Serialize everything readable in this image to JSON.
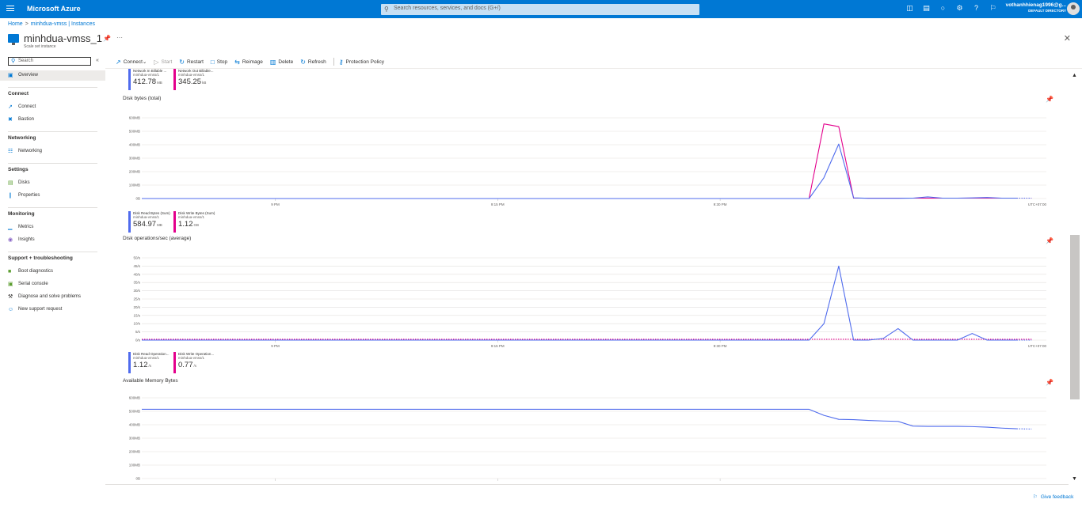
{
  "topbar": {
    "brand": "Microsoft Azure",
    "search_placeholder": "Search resources, services, and docs (G+/)",
    "icons": [
      "cloud-shell-icon",
      "directory-filter-icon",
      "notifications-icon",
      "settings-icon",
      "help-icon",
      "feedback-icon"
    ],
    "user_name": "vothanhhienag1996@g...",
    "user_directory": "DEFAULT DIRECTORY"
  },
  "breadcrumb": {
    "home": "Home",
    "parent": "minhdua-vmss | Instances"
  },
  "resource": {
    "title": "minhdua-vmss_1",
    "subtitle": "Scale set instance"
  },
  "sidebar": {
    "search_placeholder": "Search",
    "items": [
      {
        "type": "item",
        "label": "Overview",
        "icon": "overview-icon",
        "active": true
      },
      {
        "type": "head",
        "label": "Connect"
      },
      {
        "type": "item",
        "label": "Connect",
        "icon": "connect-icon"
      },
      {
        "type": "item",
        "label": "Bastion",
        "icon": "bastion-icon"
      },
      {
        "type": "head",
        "label": "Networking"
      },
      {
        "type": "item",
        "label": "Networking",
        "icon": "networking-icon"
      },
      {
        "type": "head",
        "label": "Settings"
      },
      {
        "type": "item",
        "label": "Disks",
        "icon": "disks-icon"
      },
      {
        "type": "item",
        "label": "Properties",
        "icon": "properties-icon"
      },
      {
        "type": "head",
        "label": "Monitoring"
      },
      {
        "type": "item",
        "label": "Metrics",
        "icon": "metrics-icon"
      },
      {
        "type": "item",
        "label": "Insights",
        "icon": "insights-icon"
      },
      {
        "type": "head",
        "label": "Support + troubleshooting"
      },
      {
        "type": "item",
        "label": "Boot diagnostics",
        "icon": "boot-diagnostics-icon"
      },
      {
        "type": "item",
        "label": "Serial console",
        "icon": "serial-console-icon"
      },
      {
        "type": "item",
        "label": "Diagnose and solve problems",
        "icon": "wrench-icon"
      },
      {
        "type": "item",
        "label": "New support request",
        "icon": "support-icon"
      }
    ]
  },
  "toolbar": {
    "buttons": [
      {
        "label": "Connect",
        "icon": "connect-icon",
        "dropdown": true,
        "disabled": false
      },
      {
        "label": "Start",
        "icon": "play-icon",
        "disabled": true
      },
      {
        "label": "Restart",
        "icon": "restart-icon",
        "disabled": false
      },
      {
        "label": "Stop",
        "icon": "stop-icon",
        "disabled": false
      },
      {
        "label": "Reimage",
        "icon": "reimage-icon",
        "disabled": false
      },
      {
        "label": "Delete",
        "icon": "trash-icon",
        "disabled": false
      },
      {
        "label": "Refresh",
        "icon": "refresh-icon",
        "disabled": false
      },
      {
        "label": "Protection Policy",
        "icon": "key-icon",
        "disabled": false,
        "separator_before": true
      }
    ]
  },
  "top_legend": [
    {
      "name": "Network In Billable ...",
      "resource": "minhdua-vmss/1",
      "value": "412.78",
      "unit": "MB",
      "color": "#4f6bed"
    },
    {
      "name": "Network Out Billable...",
      "resource": "minhdua-vmss/1",
      "value": "345.25",
      "unit": "kB",
      "color": "#e3008c"
    }
  ],
  "charts": {
    "disk_bytes": {
      "title": "Disk bytes (total)",
      "legend": [
        {
          "name": "Disk Read Bytes (Sum)",
          "resource": "minhdua-vmss/1",
          "value": "584.97",
          "unit": "MB",
          "color": "#4f6bed"
        },
        {
          "name": "Disk Write Bytes (Sum)",
          "resource": "minhdua-vmss/1",
          "value": "1.12",
          "unit": "GB",
          "color": "#e3008c"
        }
      ]
    },
    "disk_ops": {
      "title": "Disk operations/sec (average)",
      "legend": [
        {
          "name": "Disk Read Operation...",
          "resource": "minhdua-vmss/1",
          "value": "1.12",
          "unit": "/s",
          "color": "#4f6bed"
        },
        {
          "name": "Disk Write Operation...",
          "resource": "minhdua-vmss/1",
          "value": "0.77",
          "unit": "/s",
          "color": "#e3008c"
        }
      ]
    },
    "memory": {
      "title": "Available Memory Bytes"
    }
  },
  "chart_data": [
    {
      "type": "line",
      "title": "Disk bytes (total)",
      "y_ticks": [
        "0B",
        "100MB",
        "200MB",
        "300MB",
        "400MB",
        "500MB",
        "600MB"
      ],
      "ylim": [
        0,
        600
      ],
      "y_unit": "MB",
      "x_ticks": [
        "9 PM",
        "9:15 PM",
        "9:30 PM"
      ],
      "x_tick_minutes": [
        0,
        15,
        30
      ],
      "xlim": [
        -9,
        52
      ],
      "timezone_label": "UTC+07:00",
      "series": [
        {
          "name": "Disk Read Bytes (Sum)",
          "color": "#4f6bed",
          "x": [
            -9,
            36,
            37,
            38,
            39,
            40,
            41,
            42,
            43,
            44,
            45,
            46,
            47,
            48,
            49,
            50,
            51
          ],
          "y": [
            0,
            0,
            155,
            405,
            5,
            2,
            2,
            2,
            3,
            12,
            3,
            3,
            5,
            8,
            3,
            3,
            3
          ]
        },
        {
          "name": "Disk Write Bytes (Sum)",
          "color": "#e3008c",
          "x": [
            -9,
            36,
            37,
            38,
            39,
            40,
            41,
            42,
            43,
            44,
            45,
            46,
            47,
            48,
            49,
            50,
            51
          ],
          "y": [
            0,
            0,
            555,
            535,
            3,
            3,
            3,
            3,
            3,
            3,
            3,
            3,
            3,
            3,
            3,
            3,
            3
          ]
        }
      ]
    },
    {
      "type": "line",
      "title": "Disk operations/sec (average)",
      "y_ticks": [
        "0/s",
        "5/s",
        "10/s",
        "15/s",
        "20/s",
        "25/s",
        "30/s",
        "35/s",
        "40/s",
        "45/s",
        "50/s"
      ],
      "ylim": [
        0,
        50
      ],
      "y_unit": "/s",
      "x_ticks": [
        "9 PM",
        "9:15 PM",
        "9:30 PM"
      ],
      "x_tick_minutes": [
        0,
        15,
        30
      ],
      "xlim": [
        -9,
        52
      ],
      "timezone_label": "UTC+07:00",
      "series": [
        {
          "name": "Disk Read Operation...",
          "color": "#4f6bed",
          "x": [
            -9,
            36,
            37,
            38,
            39,
            40,
            41,
            42,
            43,
            44,
            45,
            46,
            47,
            48,
            49,
            50,
            51
          ],
          "y": [
            0,
            0,
            10,
            45,
            0,
            0,
            1,
            7,
            0,
            0,
            0,
            0,
            4,
            0,
            0,
            0,
            0
          ]
        },
        {
          "name": "Disk Write Operation...",
          "color": "#e3008c",
          "x": [
            -9,
            51
          ],
          "y": [
            0.5,
            0.5
          ]
        }
      ]
    },
    {
      "type": "line",
      "title": "Available Memory Bytes",
      "y_ticks": [
        "0B",
        "100MB",
        "200MB",
        "300MB",
        "400MB",
        "500MB",
        "600MB"
      ],
      "ylim": [
        0,
        600
      ],
      "y_unit": "MB",
      "xlim": [
        -9,
        52
      ],
      "x_tick_minutes": [
        0,
        15,
        30
      ],
      "series": [
        {
          "name": "Available Memory",
          "color": "#4f6bed",
          "x": [
            -9,
            36,
            37,
            38,
            39,
            40,
            41,
            42,
            43,
            44,
            45,
            46,
            47,
            48,
            49,
            50,
            51
          ],
          "y": [
            515,
            515,
            470,
            440,
            438,
            432,
            428,
            425,
            390,
            388,
            388,
            388,
            386,
            382,
            375,
            370,
            368
          ]
        }
      ]
    }
  ],
  "feedback": {
    "label": "Give feedback"
  }
}
